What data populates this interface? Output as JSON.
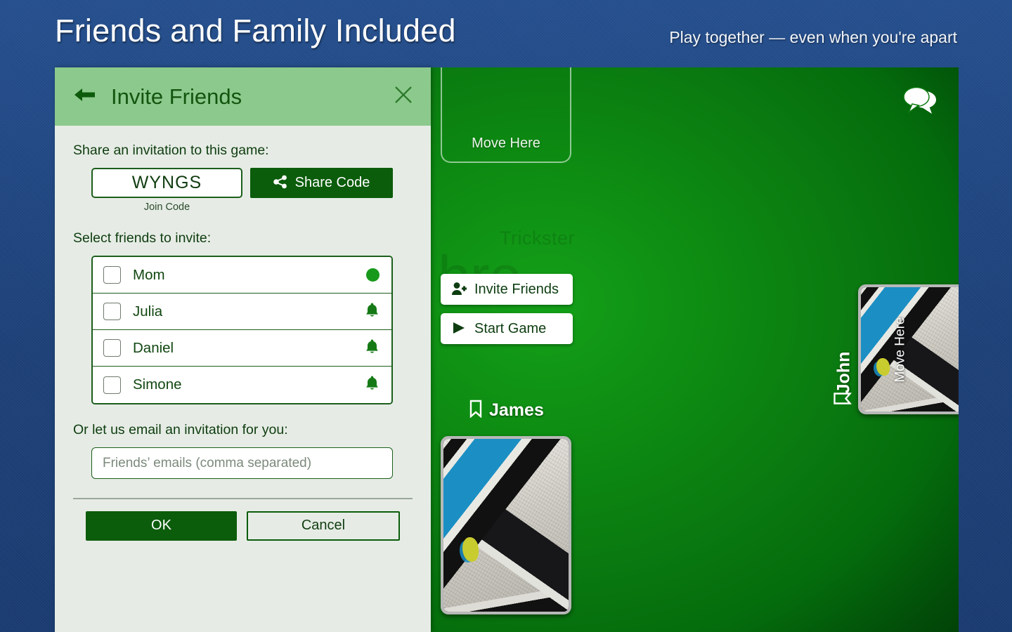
{
  "header": {
    "title": "Friends and Family Included",
    "subtitle": "Play together — even when you're apart"
  },
  "dialog": {
    "title": "Invite Friends",
    "back_icon": "back-arrow-icon",
    "close_icon": "close-icon",
    "share_section_label": "Share an invitation to this game:",
    "join_code": "WYNGS",
    "join_code_caption": "Join Code",
    "share_code_label": "Share Code",
    "share_icon": "share-icon",
    "select_friends_label": "Select friends to invite:",
    "friends": [
      {
        "name": "Mom",
        "status_icon": "online-dot-icon",
        "checked": false
      },
      {
        "name": "Julia",
        "status_icon": "bell-icon",
        "checked": false
      },
      {
        "name": "Daniel",
        "status_icon": "bell-icon",
        "checked": false
      },
      {
        "name": "Simone",
        "status_icon": "bell-icon",
        "checked": false
      }
    ],
    "email_section_label": "Or let us email an invitation for you:",
    "email_placeholder": "Friends’ emails (comma separated)",
    "email_value": "",
    "ok_label": "OK",
    "cancel_label": "Cancel"
  },
  "table": {
    "watermark_name": "Trickster",
    "watermark_sub": "hre",
    "chat_icon": "chat-bubbles-icon",
    "top_slot_label": "Move Here",
    "right_card_slot_label": "Move Here",
    "actions": [
      {
        "label": "Invite Friends",
        "icon": "add-person-icon"
      },
      {
        "label": "Start Game",
        "icon": "play-icon"
      }
    ],
    "players": [
      {
        "name": "James",
        "icon": "bookmark-icon",
        "position": "bottom"
      },
      {
        "name": "John",
        "icon": "bookmark-icon",
        "position": "right"
      }
    ]
  },
  "colors": {
    "denim_blue": "#1e4580",
    "header_green": "#8cc98c",
    "primary_green": "#0b5c0b",
    "table_green": "#0d8a12",
    "panel_bg": "#e6ece5",
    "online_green": "#18991b"
  }
}
